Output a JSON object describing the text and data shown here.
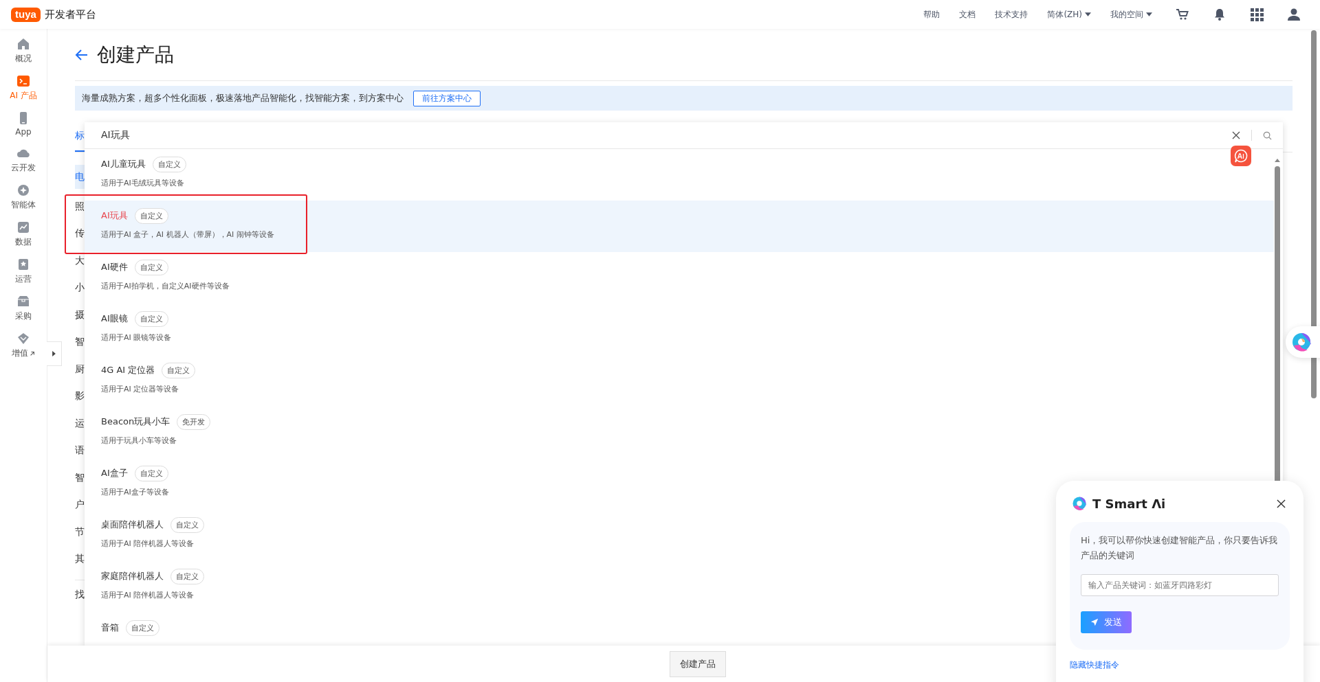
{
  "header": {
    "logo_text": "tuya",
    "title": "开发者平台",
    "nav": [
      {
        "label": "帮助",
        "kind": "link"
      },
      {
        "label": "文档",
        "kind": "link"
      },
      {
        "label": "技术支持",
        "kind": "link"
      },
      {
        "label": "简体(ZH)",
        "kind": "menu"
      },
      {
        "label": "我的空间",
        "kind": "menu"
      }
    ],
    "icons": [
      {
        "kind": "cart"
      },
      {
        "kind": "bell"
      },
      {
        "kind": "apps"
      },
      {
        "kind": "user"
      }
    ]
  },
  "sidebar": {
    "items": [
      {
        "label": "概况",
        "kind": "home",
        "selected": false,
        "external": false
      },
      {
        "label": "AI 产品",
        "kind": "terminal",
        "selected": true,
        "external": false
      },
      {
        "label": "App",
        "kind": "phone",
        "selected": false,
        "external": false
      },
      {
        "label": "云开发",
        "kind": "cloud",
        "selected": false,
        "external": false
      },
      {
        "label": "智能体",
        "kind": "agent",
        "selected": false,
        "external": false
      },
      {
        "label": "数据",
        "kind": "chart",
        "selected": false,
        "external": false
      },
      {
        "label": "运营",
        "kind": "bookmark",
        "selected": false,
        "external": false
      },
      {
        "label": "采购",
        "kind": "box",
        "selected": false,
        "external": false
      },
      {
        "label": "增值",
        "kind": "gem",
        "selected": false,
        "external": true
      }
    ]
  },
  "page": {
    "title": "创建产品",
    "banner": {
      "text": "海量成熟方案，超多个性化面板，极速落地产品智能化，找智能方案，到方案中心",
      "button": "前往方案中心"
    },
    "tabs": [
      {
        "label": "标",
        "selected": true
      }
    ],
    "categories": [
      {
        "label": "电",
        "selected": true
      },
      {
        "label": "照",
        "selected": false
      },
      {
        "label": "传",
        "selected": false
      },
      {
        "label": "大",
        "selected": false
      },
      {
        "label": "小",
        "selected": false
      },
      {
        "label": "摄",
        "selected": false
      },
      {
        "label": "智",
        "selected": false
      },
      {
        "label": "厨",
        "selected": false
      },
      {
        "label": "影",
        "selected": false
      },
      {
        "label": "运",
        "selected": false
      },
      {
        "label": "语",
        "selected": false
      },
      {
        "label": "智",
        "selected": false
      },
      {
        "label": "户",
        "selected": false
      },
      {
        "label": "节",
        "selected": false
      },
      {
        "label": "其",
        "selected": false
      }
    ],
    "more_category": "找",
    "create_button": "创建产品"
  },
  "search": {
    "value": "AI玩具",
    "results": [
      {
        "title": "AI儿童玩具",
        "tag": "自定义",
        "desc": "适用于AI毛绒玩具等设备",
        "selected": false
      },
      {
        "title": "AI玩具",
        "tag": "自定义",
        "desc": "适用于AI 盒子，AI 机器人（带屏），AI 闹钟等设备",
        "selected": true
      },
      {
        "title": "AI硬件",
        "tag": "自定义",
        "desc": "适用于AI拍学机，自定义AI硬件等设备",
        "selected": false
      },
      {
        "title": "AI眼镜",
        "tag": "自定义",
        "desc": "适用于AI 眼镜等设备",
        "selected": false
      },
      {
        "title": "4G AI 定位器",
        "tag": "自定义",
        "desc": "适用于AI 定位器等设备",
        "selected": false
      },
      {
        "title": "Beacon玩具小车",
        "tag": "免开发",
        "desc": "适用于玩具小车等设备",
        "selected": false
      },
      {
        "title": "AI盒子",
        "tag": "自定义",
        "desc": "适用于AI盒子等设备",
        "selected": false
      },
      {
        "title": "桌面陪伴机器人",
        "tag": "自定义",
        "desc": "适用于AI 陪伴机器人等设备",
        "selected": false
      },
      {
        "title": "家庭陪伴机器人",
        "tag": "自定义",
        "desc": "适用于AI 陪伴机器人等设备",
        "selected": false
      },
      {
        "title": "音箱",
        "tag": "自定义",
        "selected": false
      }
    ]
  },
  "assistant": {
    "title": "T Smart Λi",
    "message": "Hi，我可以帮你快速创建智能产品，你只要告诉我产品的关键词",
    "placeholder": "输入产品关键词：如蓝牙四路彩灯",
    "send": "发送",
    "hide_link": "隐藏快捷指令"
  }
}
